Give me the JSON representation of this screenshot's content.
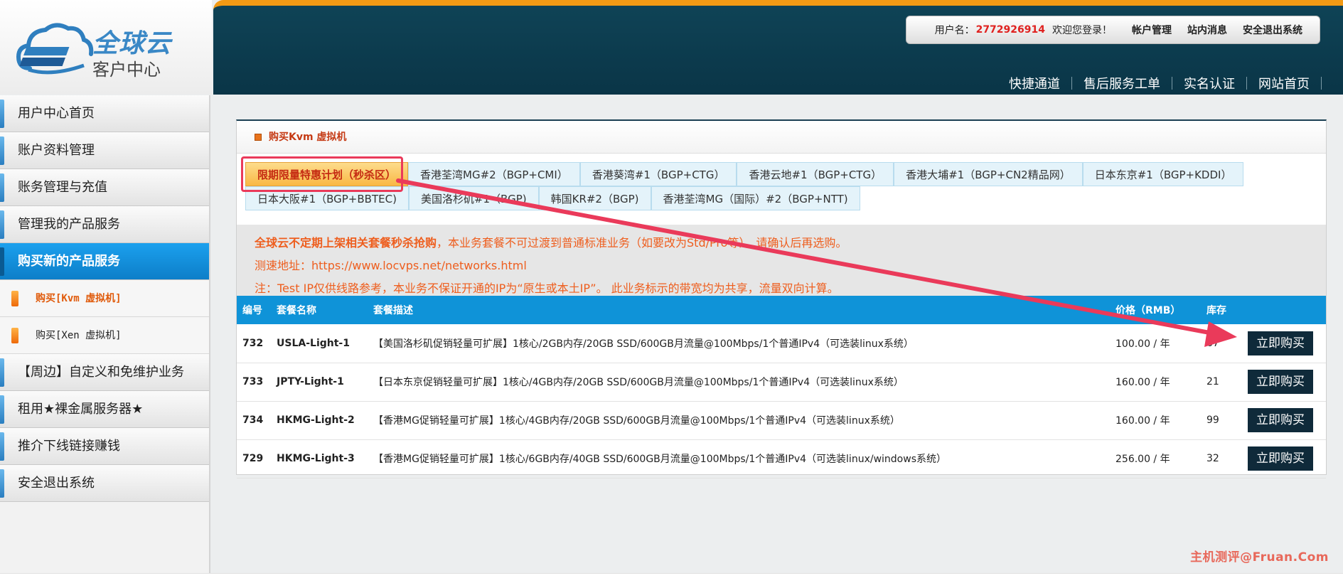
{
  "brand": {
    "title": "全球云",
    "subtitle": "客户中心"
  },
  "header": {
    "user_label": "用户名：",
    "user_id": "2772926914",
    "welcome": "欢迎您登录！",
    "links": [
      "帐户管理",
      "站内消息",
      "安全退出系统"
    ],
    "nav": [
      "快捷通道",
      "售后服务工单",
      "实名认证",
      "网站首页"
    ]
  },
  "sidebar": {
    "items": [
      {
        "label": "用户中心首页"
      },
      {
        "label": "账户资料管理"
      },
      {
        "label": "账务管理与充值"
      },
      {
        "label": "管理我的产品服务"
      },
      {
        "label": "购买新的产品服务"
      },
      {
        "label": "【周边】自定义和免维护业务"
      },
      {
        "label": "租用★裸金属服务器★"
      },
      {
        "label": "推介下线链接赚钱"
      },
      {
        "label": "安全退出系统"
      }
    ],
    "sub_items": [
      {
        "label": "购买[Kvm 虚拟机]"
      },
      {
        "label": "购买[Xen 虚拟机]"
      }
    ]
  },
  "panel": {
    "title": "购买Kvm 虚拟机",
    "tabs_row1": [
      "限期限量特惠计划（秒杀区）",
      "香港荃湾MG#2（BGP+CMI）",
      "香港葵湾#1（BGP+CTG）",
      "香港云地#1（BGP+CTG）",
      "香港大埔#1（BGP+CN2精品网）",
      "日本东京#1（BGP+KDDI）"
    ],
    "tabs_row2": [
      "日本大阪#1（BGP+BBTEC)",
      "美国洛杉矶#1（BGP)",
      "韩国KR#2（BGP)",
      "香港荃湾MG（国际）#2（BGP+NTT)"
    ],
    "notice1_strong": "全球云不定期上架相关套餐秒杀抢购",
    "notice1_rest": "，本业务套餐不可过渡到普通标准业务（如要改为Std/Pro等），请确认后再选购。",
    "notice2": "测速地址：https://www.locvps.net/networks.html",
    "notice3": "注：Test IP仅供线路参考，本业务不保证开通的IP为“原生或本土IP”。 此业务标示的带宽均为共享，流量双向计算。"
  },
  "table": {
    "headers": [
      "编号",
      "套餐名称",
      "套餐描述",
      "价格（RMB）",
      "库存",
      ""
    ],
    "buy_label": "立即购买",
    "rows": [
      {
        "id": "732",
        "name": "USLA-Light-1",
        "desc": "【美国洛杉矶促销轻量可扩展】1核心/2GB内存/20GB SSD/600GB月流量@100Mbps/1个普通IPv4（可选装linux系统）",
        "price": "100.00 / 年",
        "stock": "67"
      },
      {
        "id": "733",
        "name": "JPTY-Light-1",
        "desc": "【日本东京促销轻量可扩展】1核心/4GB内存/20GB SSD/600GB月流量@100Mbps/1个普通IPv4（可选装linux系统）",
        "price": "160.00 / 年",
        "stock": "21"
      },
      {
        "id": "734",
        "name": "HKMG-Light-2",
        "desc": "【香港MG促销轻量可扩展】1核心/4GB内存/20GB SSD/600GB月流量@100Mbps/1个普通IPv4（可选装linux系统）",
        "price": "160.00 / 年",
        "stock": "99"
      },
      {
        "id": "729",
        "name": "HKMG-Light-3",
        "desc": "【香港MG促销轻量可扩展】1核心/6GB内存/40GB SSD/600GB月流量@100Mbps/1个普通IPv4（可选装linux/windows系统）",
        "price": "256.00 / 年",
        "stock": "32"
      }
    ]
  },
  "watermark": "主机测评@Fruan.Com",
  "colors": {
    "accent": "#f39a14",
    "header_bg": "#0f4356",
    "table_head": "#0f93d8",
    "annotation": "#ea3a5a"
  }
}
